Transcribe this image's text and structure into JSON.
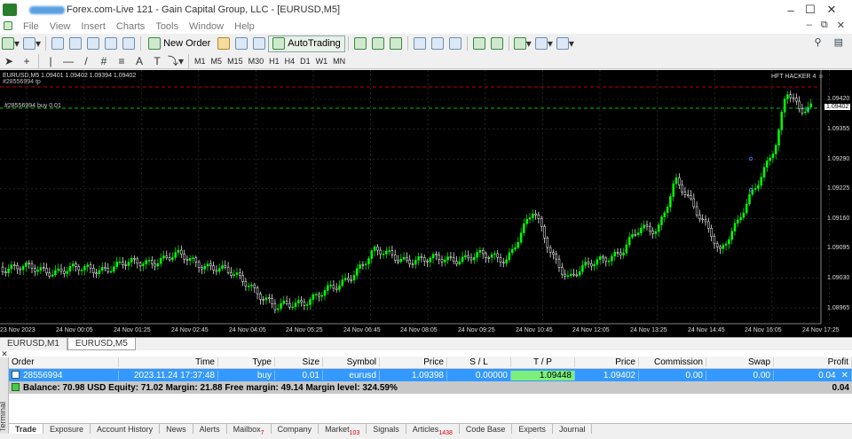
{
  "window": {
    "title": "Forex.com-Live 121 - Gain Capital Group, LLC - [EURUSD,M5]"
  },
  "menu": [
    "File",
    "View",
    "Insert",
    "Charts",
    "Tools",
    "Window",
    "Help"
  ],
  "toolbar": {
    "new_order": "New Order",
    "autotrading": "AutoTrading"
  },
  "timeframes": [
    "M1",
    "M5",
    "M15",
    "M30",
    "H1",
    "H4",
    "D1",
    "W1",
    "MN"
  ],
  "chart": {
    "symbol_line": "EURUSD,M5  1.09401 1.09402 1.09394 1.09402",
    "ea_label": "HFT HACKER 4 ☺",
    "tp_label": "#28556994 tp",
    "buy_label": "#28556994 buy 0.01",
    "price_scale": [
      "1.09420",
      "1.09355",
      "1.09290",
      "1.09225",
      "1.09160",
      "1.09095",
      "1.09030",
      "1.08965"
    ],
    "current_price": "1.09402",
    "time_axis": [
      "23 Nov 2023",
      "24 Nov 00:05",
      "24 Nov 01:25",
      "24 Nov 02:45",
      "24 Nov 04:05",
      "24 Nov 05:25",
      "24 Nov 06:45",
      "24 Nov 08:05",
      "24 Nov 09:25",
      "24 Nov 10:45",
      "24 Nov 12:05",
      "24 Nov 13:25",
      "24 Nov 14:45",
      "24 Nov 16:05",
      "24 Nov 17:25"
    ],
    "colors": {
      "bull": "#00ff00",
      "bear": "#ffffff",
      "bg": "#000000",
      "grid": "#3a3a3a",
      "tp_line": "#ff0000",
      "buy_line": "#00ff00"
    }
  },
  "chart_tabs": [
    "EURUSD,M1",
    "EURUSD,M5"
  ],
  "terminal": {
    "side_label": "Terminal",
    "headers": [
      "Order",
      "Time",
      "Type",
      "Size",
      "Symbol",
      "Price",
      "S / L",
      "T / P",
      "Price",
      "Commission",
      "Swap",
      "Profit"
    ],
    "trade": [
      "28556994",
      "2023.11.24 17:37:48",
      "buy",
      "0.01",
      "eurusd",
      "1.09398",
      "0.00000",
      "1.09448",
      "1.09402",
      "0.00",
      "0.00",
      "0.04"
    ],
    "balance_line": "Balance: 70.98 USD  Equity: 71.02  Margin: 21.88  Free margin: 49.14  Margin level: 324.59%",
    "balance_profit": "0.04",
    "tabs": [
      {
        "label": "Trade"
      },
      {
        "label": "Exposure"
      },
      {
        "label": "Account History"
      },
      {
        "label": "News"
      },
      {
        "label": "Alerts"
      },
      {
        "label": "Mailbox",
        "badge": "7"
      },
      {
        "label": "Company"
      },
      {
        "label": "Market",
        "badge": "103"
      },
      {
        "label": "Signals"
      },
      {
        "label": "Articles",
        "badge": "1438"
      },
      {
        "label": "Code Base"
      },
      {
        "label": "Experts"
      },
      {
        "label": "Journal"
      }
    ]
  }
}
